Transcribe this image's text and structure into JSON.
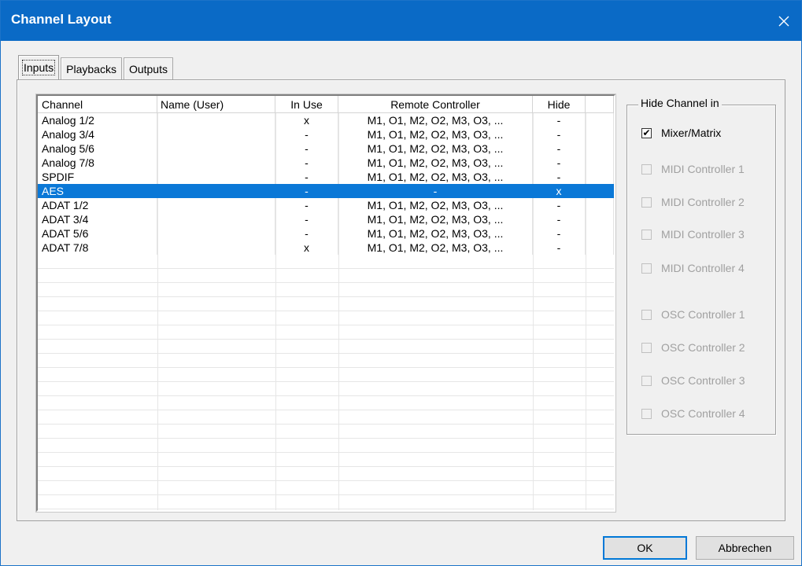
{
  "window": {
    "title": "Channel Layout",
    "close_glyph": "✕"
  },
  "tabs": [
    {
      "label": "Inputs",
      "active": true
    },
    {
      "label": "Playbacks",
      "active": false
    },
    {
      "label": "Outputs",
      "active": false
    }
  ],
  "table": {
    "columns": [
      "Channel",
      "Name (User)",
      "In Use",
      "Remote Controller",
      "Hide"
    ],
    "rows": [
      {
        "channel": "Analog 1/2",
        "name": "",
        "in_use": "x",
        "remote": "M1, O1, M2, O2, M3, O3, ...",
        "hide": "-",
        "selected": false
      },
      {
        "channel": "Analog 3/4",
        "name": "",
        "in_use": "-",
        "remote": "M1, O1, M2, O2, M3, O3, ...",
        "hide": "-",
        "selected": false
      },
      {
        "channel": "Analog 5/6",
        "name": "",
        "in_use": "-",
        "remote": "M1, O1, M2, O2, M3, O3, ...",
        "hide": "-",
        "selected": false
      },
      {
        "channel": "Analog 7/8",
        "name": "",
        "in_use": "-",
        "remote": "M1, O1, M2, O2, M3, O3, ...",
        "hide": "-",
        "selected": false
      },
      {
        "channel": "SPDIF",
        "name": "",
        "in_use": "-",
        "remote": "M1, O1, M2, O2, M3, O3, ...",
        "hide": "-",
        "selected": false
      },
      {
        "channel": "AES",
        "name": "",
        "in_use": "-",
        "remote": "-",
        "hide": "x",
        "selected": true
      },
      {
        "channel": "ADAT 1/2",
        "name": "",
        "in_use": "-",
        "remote": "M1, O1, M2, O2, M3, O3, ...",
        "hide": "-",
        "selected": false
      },
      {
        "channel": "ADAT 3/4",
        "name": "",
        "in_use": "-",
        "remote": "M1, O1, M2, O2, M3, O3, ...",
        "hide": "-",
        "selected": false
      },
      {
        "channel": "ADAT 5/6",
        "name": "",
        "in_use": "-",
        "remote": "M1, O1, M2, O2, M3, O3, ...",
        "hide": "-",
        "selected": false
      },
      {
        "channel": "ADAT 7/8",
        "name": "",
        "in_use": "x",
        "remote": "M1, O1, M2, O2, M3, O3, ...",
        "hide": "-",
        "selected": false
      }
    ]
  },
  "hide_group": {
    "title": "Hide Channel in",
    "options": [
      {
        "label": "Mixer/Matrix",
        "checked": true,
        "enabled": true
      },
      {
        "label": "MIDI Controller 1",
        "checked": false,
        "enabled": false
      },
      {
        "label": "MIDI Controller 2",
        "checked": false,
        "enabled": false
      },
      {
        "label": "MIDI Controller 3",
        "checked": false,
        "enabled": false
      },
      {
        "label": "MIDI Controller 4",
        "checked": false,
        "enabled": false
      },
      {
        "label": "OSC Controller 1",
        "checked": false,
        "enabled": false
      },
      {
        "label": "OSC Controller 2",
        "checked": false,
        "enabled": false
      },
      {
        "label": "OSC Controller 3",
        "checked": false,
        "enabled": false
      },
      {
        "label": "OSC Controller 4",
        "checked": false,
        "enabled": false
      }
    ]
  },
  "buttons": {
    "ok": "OK",
    "cancel": "Abbrechen"
  },
  "colors": {
    "titlebar": "#0a6ac6",
    "selection": "#0a78d7"
  }
}
